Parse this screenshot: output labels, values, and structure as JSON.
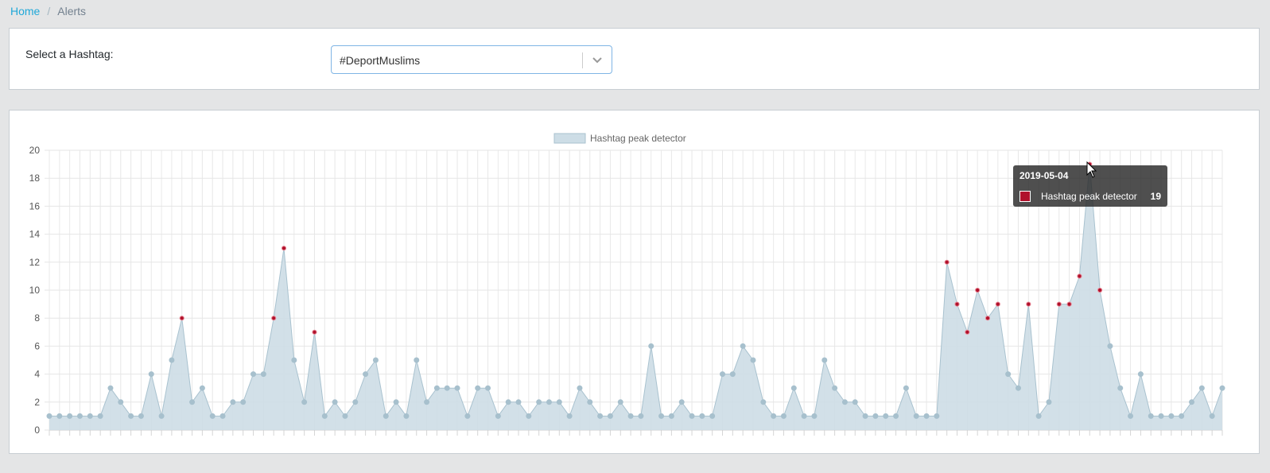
{
  "breadcrumb": {
    "home": "Home",
    "separator": "/",
    "current": "Alerts"
  },
  "hashtag_select": {
    "label": "Select a Hashtag:",
    "value": "#DeportMuslims"
  },
  "tooltip": {
    "date": "2019-05-04",
    "series": "Hashtag peak detector",
    "value": "19"
  },
  "colors": {
    "area_fill": "#cddde6",
    "line": "#a9c2cf",
    "point": "#a7c0cd",
    "peak": "#b0112b",
    "accent": "#20a8d8"
  },
  "chart_data": {
    "type": "area",
    "legend": [
      "Hashtag peak detector"
    ],
    "legend_position": "top",
    "ylim": [
      0,
      20
    ],
    "yticks": [
      0,
      2,
      4,
      6,
      8,
      10,
      12,
      14,
      16,
      18,
      20
    ],
    "grid": true,
    "series": [
      {
        "name": "Hashtag peak detector",
        "values": [
          1,
          1,
          1,
          1,
          1,
          1,
          3,
          2,
          1,
          1,
          4,
          1,
          5,
          8,
          2,
          3,
          1,
          1,
          2,
          2,
          4,
          4,
          8,
          13,
          5,
          2,
          7,
          1,
          2,
          1,
          2,
          4,
          5,
          1,
          2,
          1,
          5,
          2,
          3,
          3,
          3,
          1,
          3,
          3,
          1,
          2,
          2,
          1,
          2,
          2,
          2,
          1,
          3,
          2,
          1,
          1,
          2,
          1,
          1,
          6,
          1,
          1,
          2,
          1,
          1,
          1,
          4,
          4,
          6,
          5,
          2,
          1,
          1,
          3,
          1,
          1,
          5,
          3,
          2,
          2,
          1,
          1,
          1,
          1,
          3,
          1,
          1,
          1,
          12,
          9,
          7,
          10,
          8,
          9,
          4,
          3,
          9,
          1,
          2,
          9,
          9,
          11,
          19,
          10,
          6,
          3,
          1,
          4,
          1,
          1,
          1,
          1,
          2,
          3,
          1,
          3
        ],
        "peak_indices": [
          13,
          22,
          23,
          26,
          88,
          89,
          90,
          91,
          92,
          93,
          96,
          99,
          100,
          101,
          102,
          103
        ]
      }
    ]
  }
}
